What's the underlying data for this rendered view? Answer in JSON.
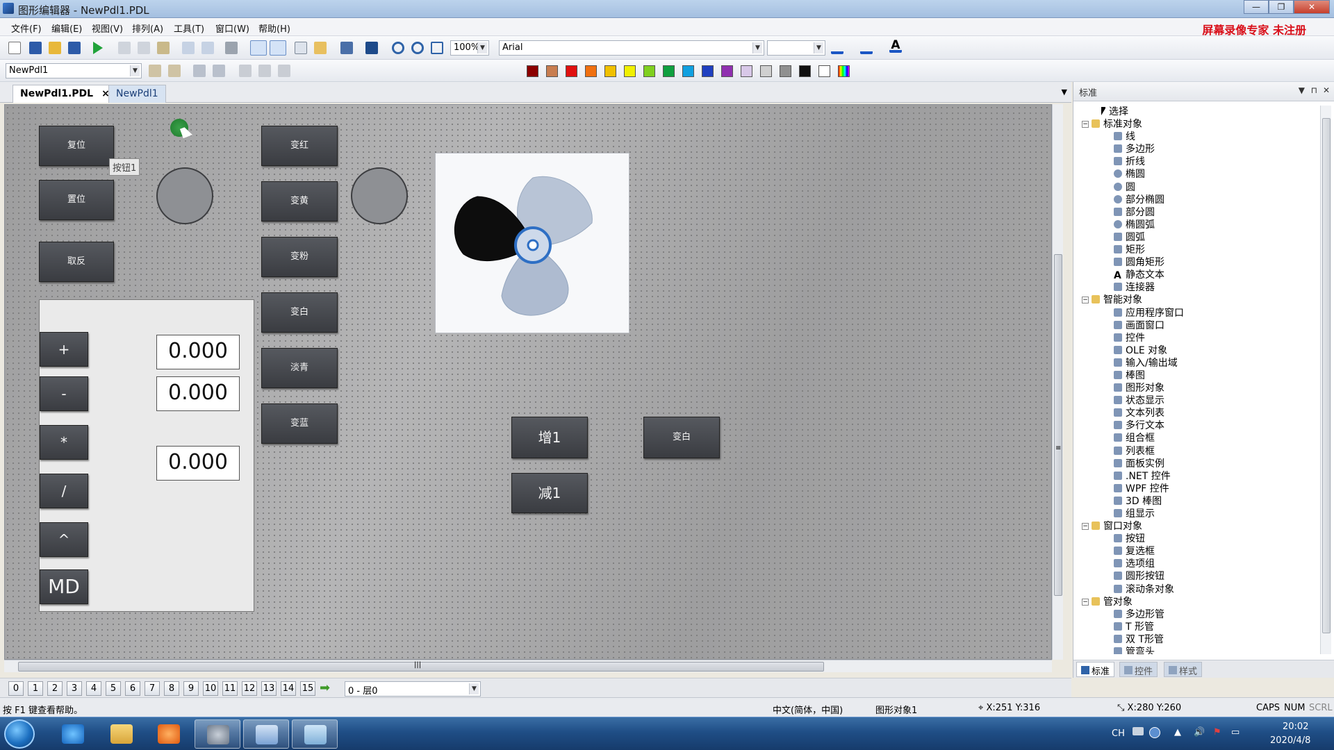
{
  "window": {
    "title": "图形编辑器 - NewPdl1.PDL",
    "min_label": "—",
    "max_label": "❐",
    "close_label": "✕"
  },
  "menu": [
    "文件(F)",
    "编辑(E)",
    "视图(V)",
    "排列(A)",
    "工具(T)",
    "窗口(W)",
    "帮助(H)"
  ],
  "recorder_note": "屏幕录像专家 未注册",
  "toolbar": {
    "zoom": "100%",
    "font": "Arial",
    "font_size": "",
    "object_selector": "NewPdl1"
  },
  "palette_colors": [
    "#8b0000",
    "#c87d50",
    "#e01010",
    "#f07010",
    "#f0c000",
    "#f0f000",
    "#80d020",
    "#10a040",
    "#10a0e0",
    "#2040c0",
    "#9030b0",
    "#d8c8e8",
    "#d0d0d0",
    "#909090",
    "#101010",
    "#ffffff",
    "rainbow"
  ],
  "tabs": [
    {
      "label": "NewPdl1.PDL",
      "active": true,
      "close": "×"
    },
    {
      "label": "NewPdl1",
      "active": false
    }
  ],
  "tabs_dropdown": "▼",
  "canvas": {
    "buttons": {
      "reset": "复位",
      "set": "置位",
      "invert": "取反",
      "red": "变红",
      "yellow": "变黄",
      "pink": "变粉",
      "white": "变白",
      "light_blue": "淡青",
      "blue": "变蓝",
      "inc": "增1",
      "dec": "减1",
      "white2": "变白"
    },
    "tooltip": "按钮1",
    "calc": {
      "plus": "+",
      "minus": "-",
      "mul": "*",
      "div": "/",
      "pow": "^",
      "md": "MD",
      "value1": "0.000",
      "value2": "0.000",
      "value3": "0.000"
    }
  },
  "hscroll_marker": "|||",
  "vscroll_marker": "≡",
  "layers": {
    "numbers": [
      "0",
      "1",
      "2",
      "3",
      "4",
      "5",
      "6",
      "7",
      "8",
      "9",
      "10",
      "11",
      "12",
      "13",
      "14",
      "15"
    ],
    "selected": "0 - 层0",
    "go_arrow": "➡"
  },
  "panel": {
    "title": "标准",
    "tree": [
      {
        "label": "选择",
        "level": 1,
        "icon": "arrow-icon"
      },
      {
        "label": "标准对象",
        "level": 0,
        "expander": "−",
        "icon": "folder-icon"
      },
      {
        "label": "线",
        "level": 2,
        "icon": "line-icon"
      },
      {
        "label": "多边形",
        "level": 2,
        "icon": "polygon-icon"
      },
      {
        "label": "折线",
        "level": 2,
        "icon": "polyline-icon"
      },
      {
        "label": "椭圆",
        "level": 2,
        "icon": "ellipse-icon"
      },
      {
        "label": "圆",
        "level": 2,
        "icon": "circle-icon"
      },
      {
        "label": "部分椭圆",
        "level": 2,
        "icon": "ellipse-segment-icon"
      },
      {
        "label": "部分圆",
        "level": 2,
        "icon": "pie-segment-icon"
      },
      {
        "label": "椭圆弧",
        "level": 2,
        "icon": "ellipse-arc-icon"
      },
      {
        "label": "圆弧",
        "level": 2,
        "icon": "arc-icon"
      },
      {
        "label": "矩形",
        "level": 2,
        "icon": "rectangle-icon"
      },
      {
        "label": "圆角矩形",
        "level": 2,
        "icon": "rounded-rect-icon"
      },
      {
        "label": "静态文本",
        "level": 2,
        "icon": "text-icon",
        "glyph": "A"
      },
      {
        "label": "连接器",
        "level": 2,
        "icon": "connector-icon"
      },
      {
        "label": "智能对象",
        "level": 0,
        "expander": "−",
        "icon": "folder-icon"
      },
      {
        "label": "应用程序窗口",
        "level": 2,
        "icon": "app-window-icon"
      },
      {
        "label": "画面窗口",
        "level": 2,
        "icon": "screen-window-icon"
      },
      {
        "label": "控件",
        "level": 2,
        "icon": "control-icon"
      },
      {
        "label": "OLE 对象",
        "level": 2,
        "icon": "ole-icon"
      },
      {
        "label": "输入/输出域",
        "level": 2,
        "icon": "io-field-icon"
      },
      {
        "label": "棒图",
        "level": 2,
        "icon": "bar-icon"
      },
      {
        "label": "图形对象",
        "level": 2,
        "icon": "graphic-object-icon"
      },
      {
        "label": "状态显示",
        "level": 2,
        "icon": "status-display-icon"
      },
      {
        "label": "文本列表",
        "level": 2,
        "icon": "text-list-icon"
      },
      {
        "label": "多行文本",
        "level": 2,
        "icon": "multiline-text-icon"
      },
      {
        "label": "组合框",
        "level": 2,
        "icon": "combobox-icon"
      },
      {
        "label": "列表框",
        "level": 2,
        "icon": "listbox-icon"
      },
      {
        "label": "面板实例",
        "level": 2,
        "icon": "panel-instance-icon"
      },
      {
        "label": ".NET 控件",
        "level": 2,
        "icon": "dotnet-icon"
      },
      {
        "label": "WPF 控件",
        "level": 2,
        "icon": "wpf-icon"
      },
      {
        "label": "3D 棒图",
        "level": 2,
        "icon": "3d-bar-icon"
      },
      {
        "label": "组显示",
        "level": 2,
        "icon": "group-display-icon"
      },
      {
        "label": "窗口对象",
        "level": 0,
        "expander": "−",
        "icon": "folder-icon"
      },
      {
        "label": "按钮",
        "level": 2,
        "icon": "button-icon"
      },
      {
        "label": "复选框",
        "level": 2,
        "icon": "checkbox-icon"
      },
      {
        "label": "选项组",
        "level": 2,
        "icon": "option-group-icon"
      },
      {
        "label": "圆形按钮",
        "level": 2,
        "icon": "round-button-icon"
      },
      {
        "label": "滚动条对象",
        "level": 2,
        "icon": "scrollbar-icon"
      },
      {
        "label": "管对象",
        "level": 0,
        "expander": "−",
        "icon": "folder-icon"
      },
      {
        "label": "多边形管",
        "level": 2,
        "icon": "polygon-tube-icon"
      },
      {
        "label": "T 形管",
        "level": 2,
        "icon": "t-tube-icon"
      },
      {
        "label": "双 T形管",
        "level": 2,
        "icon": "double-t-tube-icon"
      },
      {
        "label": "管弯头",
        "level": 2,
        "icon": "elbow-tube-icon"
      }
    ],
    "bottom_tabs": [
      "标准",
      "控件",
      "样式"
    ]
  },
  "statusbar": {
    "help": "按 F1 键查看帮助。",
    "locale": "中文(简体，中国)",
    "object": "图形对象1",
    "position": "X:251 Y:316",
    "size": "X:280 Y:260",
    "caps": "CAPS",
    "num": "NUM",
    "scrl": "SCRL"
  },
  "taskbar": {
    "lang": "CH",
    "time": "20:02",
    "date": "2020/4/8"
  }
}
